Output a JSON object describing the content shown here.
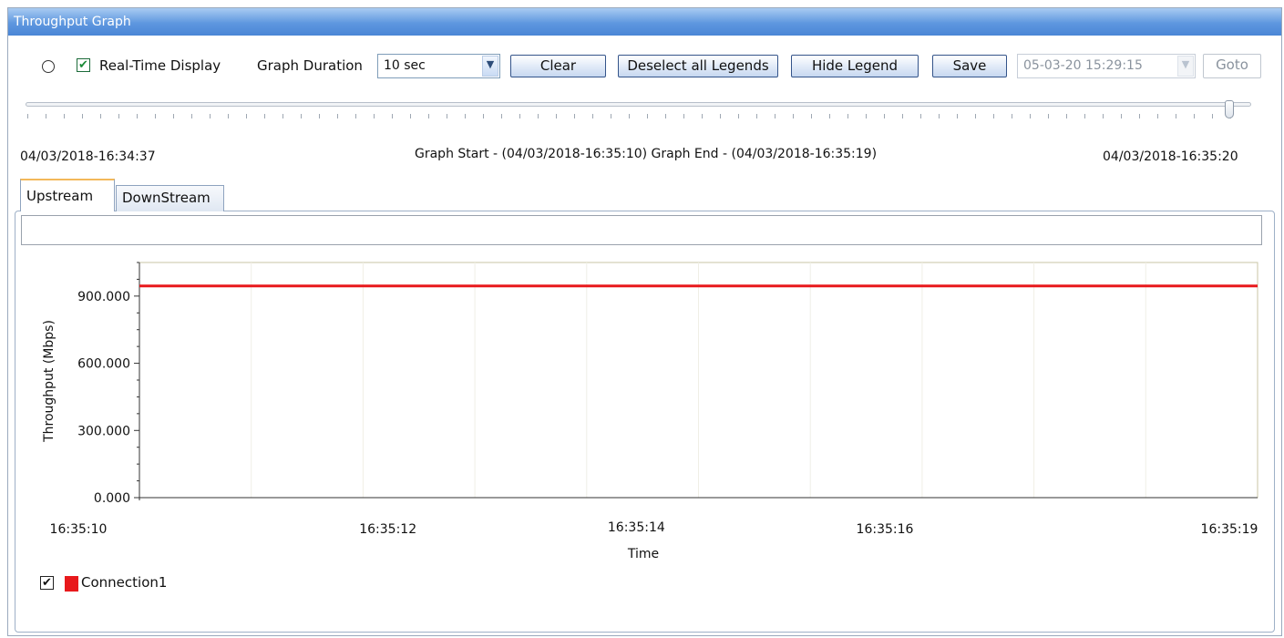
{
  "window": {
    "title": "Throughput Graph"
  },
  "toolbar": {
    "realtime_label": "Real-Time Display",
    "realtime_checked": true,
    "duration_label": "Graph Duration",
    "duration_value": "10 sec",
    "clear_label": "Clear",
    "deselect_label": "Deselect all Legends",
    "hide_legend_label": "Hide Legend",
    "save_label": "Save",
    "datetime_value": "05-03-20 15:29:15",
    "goto_label": "Goto"
  },
  "timeline": {
    "start": "04/03/2018-16:34:37",
    "range": "Graph Start - (04/03/2018-16:35:10) Graph End - (04/03/2018-16:35:19)",
    "end": "04/03/2018-16:35:20"
  },
  "tabs": [
    {
      "label": "Upstream",
      "active": true
    },
    {
      "label": "DownStream",
      "active": false
    }
  ],
  "chart_data": {
    "type": "line",
    "xlabel": "Time",
    "ylabel": "Throughput (Mbps)",
    "ylim": [
      0,
      1050
    ],
    "yticks": [
      "0.000",
      "300.000",
      "600.000",
      "900.000"
    ],
    "ytick_values": [
      0,
      300,
      600,
      900
    ],
    "xtick_labels": [
      "16:35:10",
      "16:35:12",
      "16:35:14",
      "16:35:16",
      "16:35:19"
    ],
    "xtick_values": [
      0,
      2,
      4,
      6,
      9
    ],
    "xlim": [
      0,
      9
    ],
    "series": [
      {
        "name": "Connection1",
        "color": "#e8191c",
        "x": [
          0,
          9
        ],
        "y": [
          945,
          945
        ]
      }
    ]
  },
  "legend": {
    "items": [
      {
        "label": "Connection1",
        "checked": true,
        "color": "#e8191c"
      }
    ]
  }
}
